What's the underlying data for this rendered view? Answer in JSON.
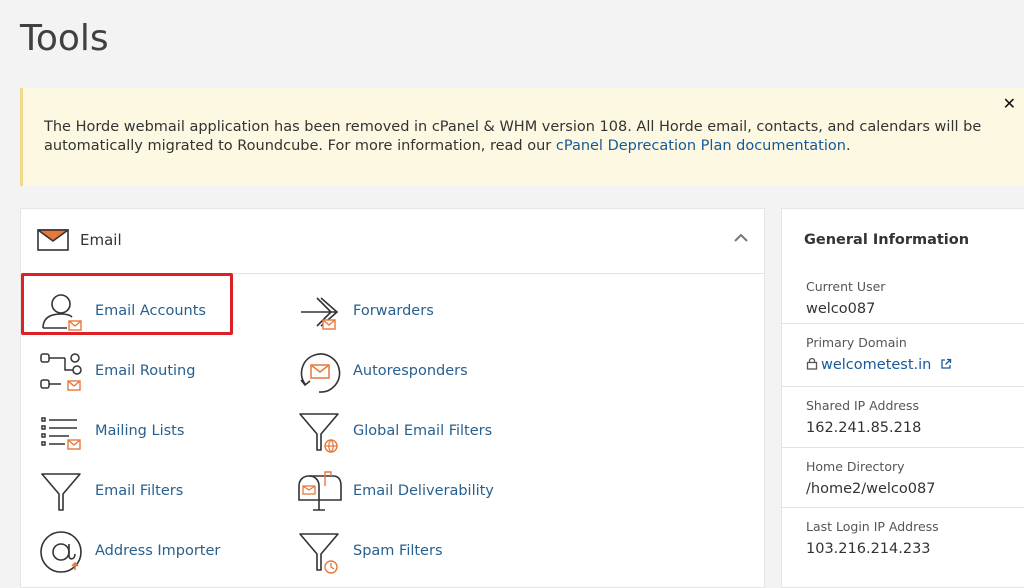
{
  "page": {
    "title": "Tools"
  },
  "notice": {
    "text_before": "The Horde webmail application has been removed in cPanel & WHM version 108. All Horde email, contacts, and calendars will be automatically migrated to Roundcube. For more information, read our ",
    "link_text": "cPanel Deprecation Plan documentation",
    "text_after": ".",
    "close_label": "✕"
  },
  "email_panel": {
    "title": "Email",
    "tools": [
      {
        "label": "Email Accounts",
        "icon": "user-mail-icon"
      },
      {
        "label": "Forwarders",
        "icon": "forward-arrow-icon"
      },
      {
        "label": "Email Routing",
        "icon": "routing-icon"
      },
      {
        "label": "Autoresponders",
        "icon": "autoresponder-icon"
      },
      {
        "label": "Mailing Lists",
        "icon": "list-icon"
      },
      {
        "label": "Global Email Filters",
        "icon": "funnel-globe-icon"
      },
      {
        "label": "Email Filters",
        "icon": "funnel-icon"
      },
      {
        "label": "Email Deliverability",
        "icon": "mailbox-icon"
      },
      {
        "label": "Address Importer",
        "icon": "at-sign-icon"
      },
      {
        "label": "Spam Filters",
        "icon": "funnel-clock-icon"
      }
    ]
  },
  "general_info": {
    "title": "General Information",
    "current_user_label": "Current User",
    "current_user": "welco087",
    "primary_domain_label": "Primary Domain",
    "primary_domain": "welcometest.in",
    "shared_ip_label": "Shared IP Address",
    "shared_ip": "162.241.85.218",
    "home_dir_label": "Home Directory",
    "home_dir": "/home2/welco087",
    "last_login_label": "Last Login IP Address",
    "last_login": "103.216.214.233"
  },
  "colors": {
    "accent_orange": "#e8773a",
    "link_blue": "#27608f",
    "highlight_red": "#dd1f26",
    "notice_bg": "#fcf8e1"
  }
}
